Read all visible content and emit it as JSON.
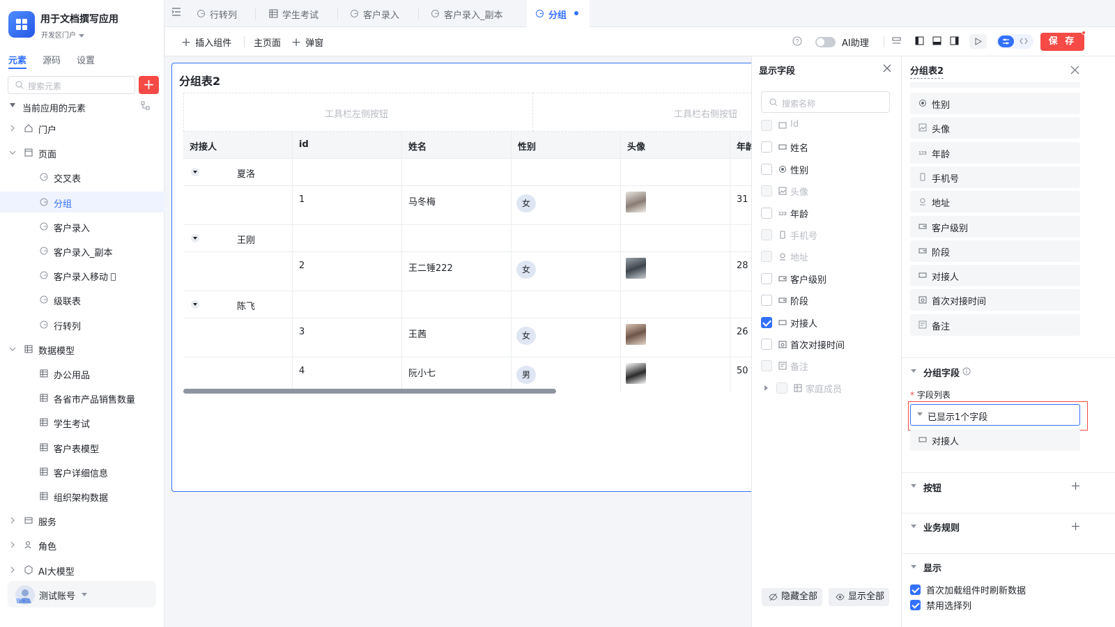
{
  "app": {
    "title": "用于文档撰写应用",
    "env": "开发区门户"
  },
  "sidebar": {
    "tabs": [
      "元素",
      "源码",
      "设置"
    ],
    "search_placeholder": "搜索元素",
    "section_title": "当前应用的元素",
    "tree": [
      {
        "label": "门户",
        "icon": "home-icon",
        "level": 0,
        "expandable": true,
        "expanded": false
      },
      {
        "label": "页面",
        "icon": "page-icon",
        "level": 0,
        "expandable": true,
        "expanded": true
      },
      {
        "label": "交叉表",
        "icon": "page-item-icon",
        "level": 1
      },
      {
        "label": "分组",
        "icon": "page-item-icon",
        "level": 1,
        "selected": true
      },
      {
        "label": "客户录入",
        "icon": "page-item-icon",
        "level": 1
      },
      {
        "label": "客户录入_副本",
        "icon": "page-item-icon",
        "level": 1
      },
      {
        "label": "客户录入移动",
        "icon": "page-item-icon",
        "level": 1,
        "mobile": true
      },
      {
        "label": "级联表",
        "icon": "page-item-icon",
        "level": 1
      },
      {
        "label": "行转列",
        "icon": "page-item-icon",
        "level": 1
      },
      {
        "label": "数据模型",
        "icon": "table-icon",
        "level": 0,
        "expandable": true,
        "expanded": true
      },
      {
        "label": "办公用品",
        "icon": "table-icon",
        "level": 1
      },
      {
        "label": "各省市产品销售数量",
        "icon": "table-icon",
        "level": 1
      },
      {
        "label": "学生考试",
        "icon": "table-icon",
        "level": 1
      },
      {
        "label": "客户表模型",
        "icon": "table-icon",
        "level": 1
      },
      {
        "label": "客户详细信息",
        "icon": "table-icon",
        "level": 1
      },
      {
        "label": "组织架构数据",
        "icon": "table-icon",
        "level": 1
      },
      {
        "label": "服务",
        "icon": "service-icon",
        "level": 0,
        "expandable": true,
        "expanded": false
      },
      {
        "label": "角色",
        "icon": "role-icon",
        "level": 0,
        "expandable": true,
        "expanded": false
      },
      {
        "label": "AI大模型",
        "icon": "ai-model-icon",
        "level": 0,
        "expandable": true,
        "expanded": false
      }
    ],
    "account": {
      "name": "测试账号",
      "role_tag": "管理员"
    }
  },
  "tabs": [
    {
      "label": "行转列",
      "active": false
    },
    {
      "label": "学生考试",
      "active": false
    },
    {
      "label": "客户录入",
      "active": false
    },
    {
      "label": "客户录入_副本",
      "active": false
    },
    {
      "label": "分组",
      "active": true,
      "unsaved": true
    }
  ],
  "toolbar": {
    "insert_label": "插入组件",
    "home_label": "主页面",
    "popup_label": "弹窗",
    "ai_label": "AI助理",
    "save_label": "保 存"
  },
  "canvas": {
    "title": "分组表2",
    "toolbar_left": "工具栏左侧按钮",
    "toolbar_right": "工具栏右侧按钮",
    "columns": [
      "对接人",
      "id",
      "姓名",
      "性别",
      "头像",
      "年龄"
    ],
    "groups": [
      {
        "name": "夏洛",
        "rows": [
          {
            "id": "1",
            "name": "马冬梅",
            "gender": "女",
            "age": "31"
          }
        ]
      },
      {
        "name": "王刚",
        "rows": [
          {
            "id": "2",
            "name": "王二锤222",
            "gender": "女",
            "age": "28"
          }
        ]
      },
      {
        "name": "陈飞",
        "rows": [
          {
            "id": "3",
            "name": "王茜",
            "gender": "女",
            "age": "26"
          },
          {
            "id": "4",
            "name": "阮小七",
            "gender": "男",
            "age": "50"
          }
        ]
      }
    ]
  },
  "fields_panel": {
    "title": "显示字段",
    "search_placeholder": "搜索名称",
    "fields": [
      {
        "label": "Id",
        "icon": "id-icon",
        "checked": false,
        "disabled": true
      },
      {
        "label": "姓名",
        "icon": "text-field-icon",
        "checked": false,
        "disabled": false
      },
      {
        "label": "性别",
        "icon": "radio-field-icon",
        "checked": false,
        "disabled": false
      },
      {
        "label": "头像",
        "icon": "image-field-icon",
        "checked": false,
        "disabled": true
      },
      {
        "label": "年龄",
        "icon": "number-field-icon",
        "checked": false,
        "disabled": false
      },
      {
        "label": "手机号",
        "icon": "phone-field-icon",
        "checked": false,
        "disabled": true
      },
      {
        "label": "地址",
        "icon": "location-field-icon",
        "checked": false,
        "disabled": true
      },
      {
        "label": "客户级别",
        "icon": "select-field-icon",
        "checked": false,
        "disabled": false
      },
      {
        "label": "阶段",
        "icon": "select-field-icon",
        "checked": false,
        "disabled": false
      },
      {
        "label": "对接人",
        "icon": "text-field-icon",
        "checked": true,
        "disabled": false
      },
      {
        "label": "首次对接时间",
        "icon": "datetime-field-icon",
        "checked": false,
        "disabled": false
      },
      {
        "label": "备注",
        "icon": "textarea-field-icon",
        "checked": false,
        "disabled": true
      },
      {
        "label": "家庭成员",
        "icon": "subtable-field-icon",
        "checked": false,
        "disabled": true,
        "expandable": true
      }
    ],
    "hide_all": "隐藏全部",
    "show_all": "显示全部"
  },
  "props_panel": {
    "title": "分组表2",
    "field_items": [
      {
        "label": "性别",
        "icon": "radio-field-icon"
      },
      {
        "label": "头像",
        "icon": "image-field-icon"
      },
      {
        "label": "年龄",
        "icon": "number-field-icon"
      },
      {
        "label": "手机号",
        "icon": "phone-field-icon"
      },
      {
        "label": "地址",
        "icon": "location-field-icon"
      },
      {
        "label": "客户级别",
        "icon": "select-field-icon"
      },
      {
        "label": "阶段",
        "icon": "select-field-icon"
      },
      {
        "label": "对接人",
        "icon": "text-field-icon"
      },
      {
        "label": "首次对接时间",
        "icon": "datetime-field-icon"
      },
      {
        "label": "备注",
        "icon": "textarea-field-icon"
      }
    ],
    "group_section": {
      "title": "分组字段",
      "required_label": "字段列表",
      "select_value": "已显示1个字段",
      "selected_items": [
        {
          "label": "对接人",
          "icon": "text-field-icon"
        }
      ]
    },
    "buttons_section": "按钮",
    "rules_section": "业务规则",
    "display_section": {
      "title": "显示",
      "options": [
        {
          "label": "首次加载组件时刷新数据",
          "checked": true
        },
        {
          "label": "禁用选择列",
          "checked": true
        }
      ]
    }
  },
  "colors": {
    "accent": "#3370ff",
    "danger": "#f54a45"
  }
}
